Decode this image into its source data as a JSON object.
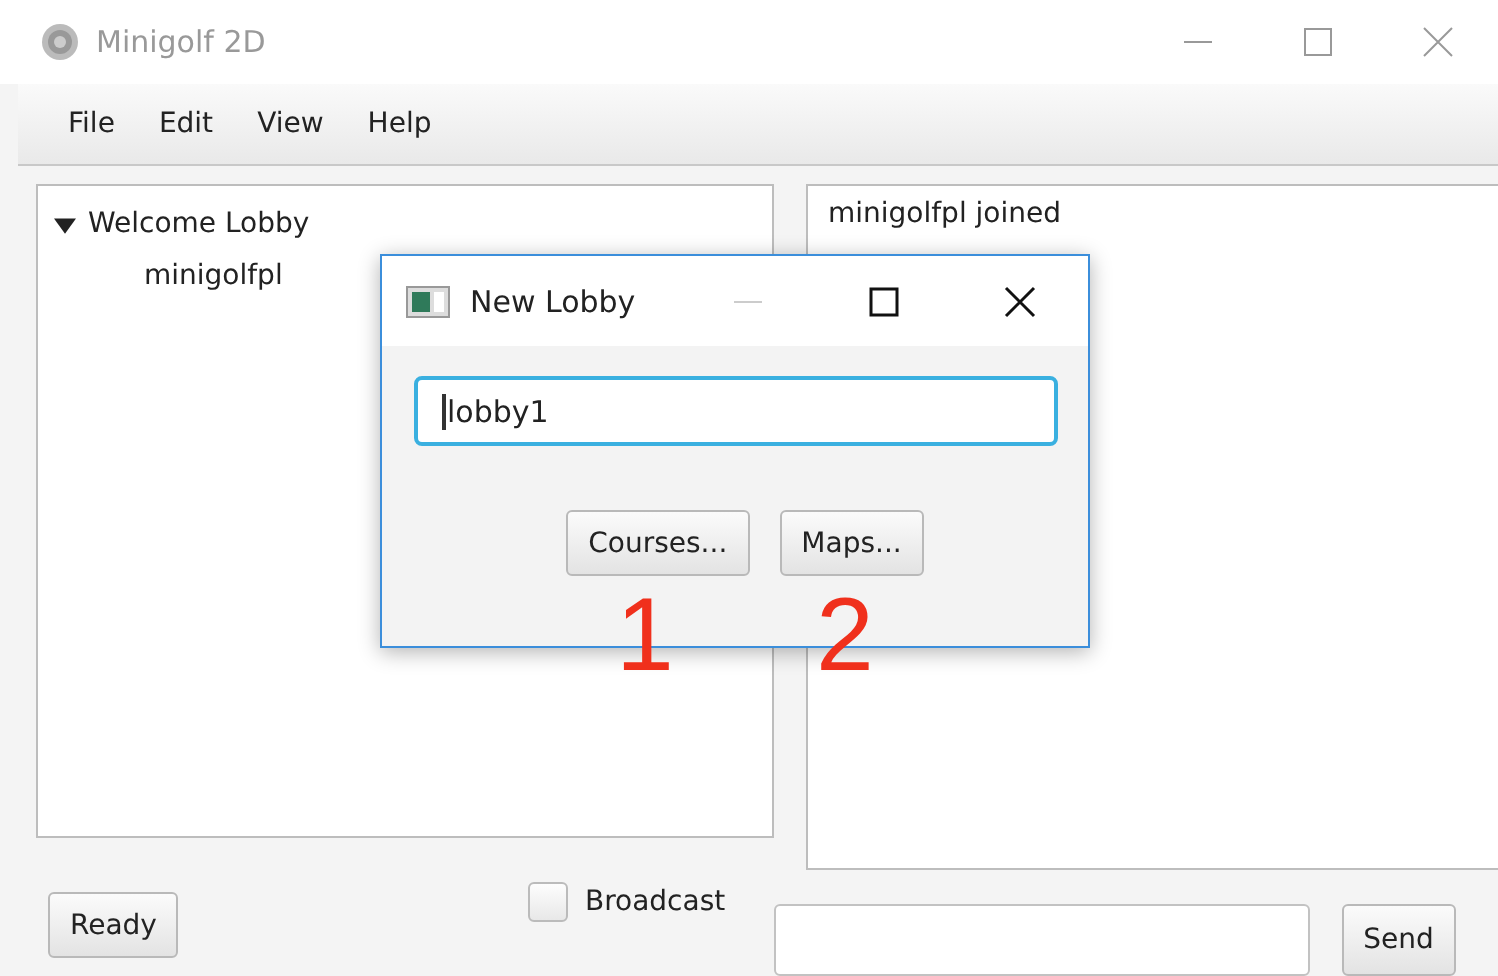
{
  "window": {
    "title": "Minigolf 2D"
  },
  "menu": [
    "File",
    "Edit",
    "View",
    "Help"
  ],
  "tree": [
    {
      "label": "Welcome Lobby",
      "expanded": true,
      "children": [
        {
          "label": "minigolfpl"
        }
      ]
    }
  ],
  "chat": {
    "lines": [
      "minigolfpl joined"
    ]
  },
  "bottom": {
    "ready_button": "Ready",
    "broadcast": {
      "label": "Broadcast",
      "checked": false
    },
    "send_button": "Send"
  },
  "dialog": {
    "title": "New Lobby",
    "name_field": {
      "value": "lobby1",
      "focused": true
    },
    "buttons": [
      "Courses...",
      "Maps..."
    ]
  },
  "annotations": [
    "1",
    "2"
  ]
}
